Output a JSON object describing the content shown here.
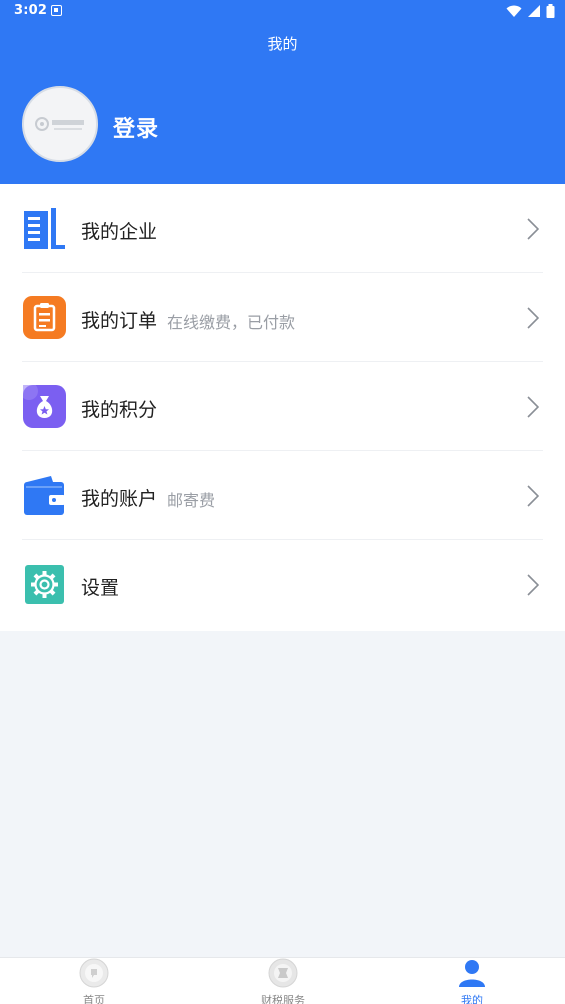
{
  "status_bar": {
    "time": "3:02"
  },
  "header": {
    "title": "我的",
    "login_label": "登录",
    "avatar_logo_text": "九洲财务"
  },
  "menu": {
    "items": [
      {
        "label": "我的企业",
        "subtitle": "",
        "icon": "building-icon"
      },
      {
        "label": "我的订单",
        "subtitle": "在线缴费，已付款",
        "icon": "clipboard-icon"
      },
      {
        "label": "我的积分",
        "subtitle": "",
        "icon": "money-bag-icon"
      },
      {
        "label": "我的账户",
        "subtitle": "邮寄费",
        "icon": "wallet-icon"
      },
      {
        "label": "设置",
        "subtitle": "",
        "icon": "gear-icon"
      }
    ]
  },
  "bottom_nav": {
    "tabs": [
      {
        "label": "首页",
        "icon": "home-icon",
        "active": false
      },
      {
        "label": "财税服务",
        "icon": "service-icon",
        "active": false
      },
      {
        "label": "我的",
        "icon": "person-icon",
        "active": true
      }
    ]
  },
  "colors": {
    "primary": "#2f78f4",
    "background": "#f2f5f9",
    "orange": "#f57b22",
    "purple": "#7b5ff1",
    "teal": "#3bbfae"
  }
}
